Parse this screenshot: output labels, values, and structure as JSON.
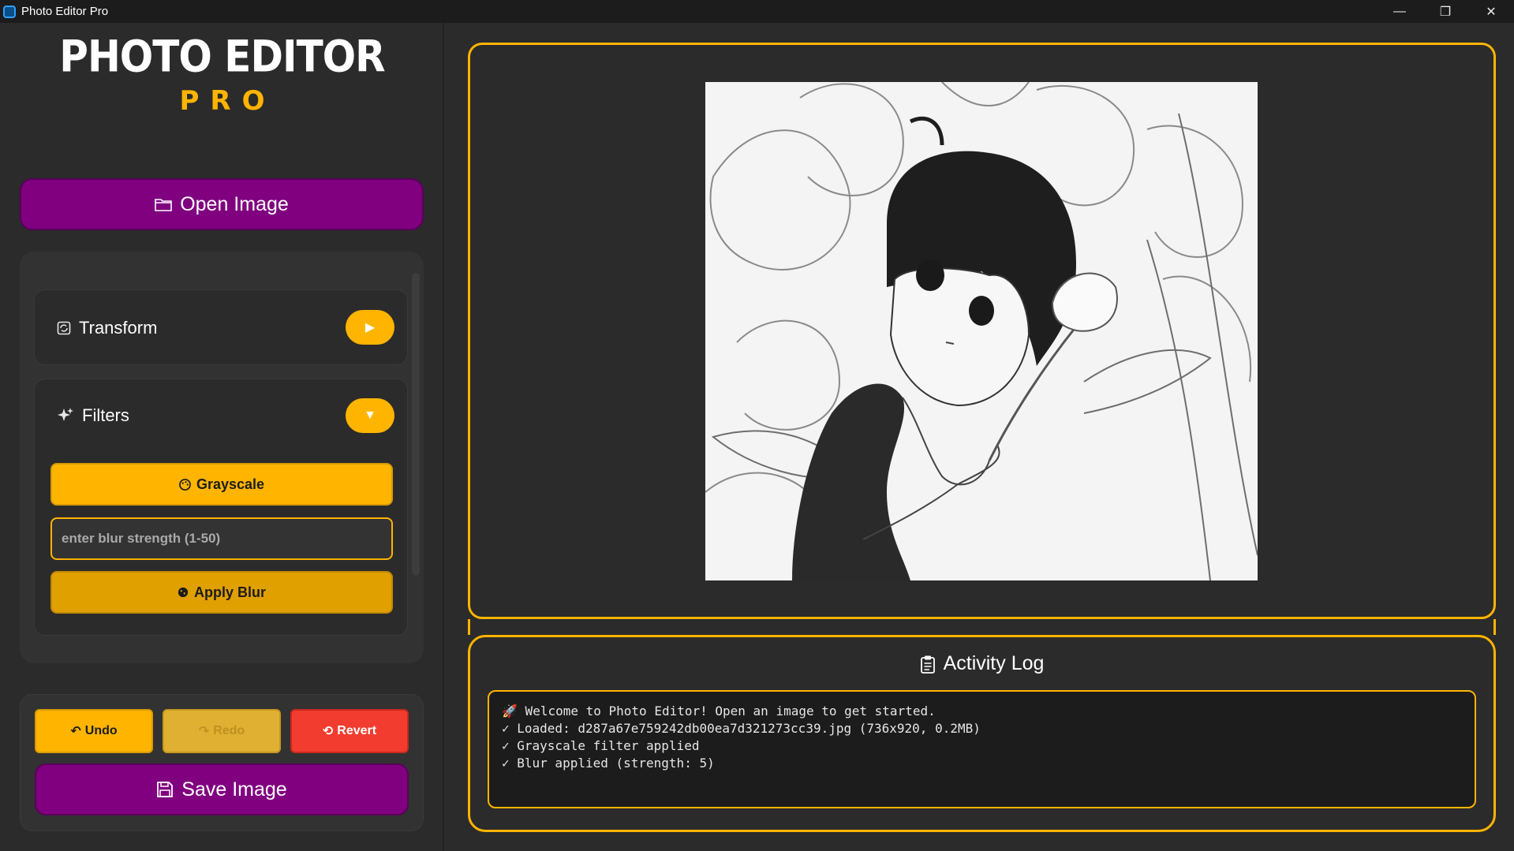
{
  "window": {
    "title": "Photo Editor Pro",
    "controls": {
      "minimize": "—",
      "restore": "❐",
      "close": "✕"
    }
  },
  "sidebar": {
    "logo_main": "PHOTO EDITOR",
    "logo_sub": "PRO",
    "open_label": "Open Image",
    "sections": {
      "transform": {
        "label": "Transform",
        "toggle": "▶",
        "expanded": false
      },
      "filters": {
        "label": "Filters",
        "toggle": "▼",
        "expanded": true,
        "grayscale_label": "Grayscale",
        "blur_placeholder": "enter blur strength (1-50)",
        "blur_value": "",
        "apply_blur_label": "Apply Blur"
      }
    },
    "history": {
      "undo_label": "Undo",
      "redo_label": "Redo",
      "revert_label": "Revert",
      "redo_enabled": false
    },
    "save_label": "Save Image"
  },
  "log": {
    "title": "Activity Log",
    "lines": [
      "🚀 Welcome to Photo Editor! Open an image to get started.",
      "✓ Loaded: d287a67e759242db00ea7d321273cc39.jpg (736x920, 0.2MB)",
      "✓ Grayscale filter applied",
      "✓ Blur applied (strength: 5)"
    ]
  },
  "colors": {
    "accent": "#ffb400",
    "primary_button": "#800080",
    "danger": "#f23c2f",
    "background": "#2b2b2b",
    "panel": "#323232"
  }
}
